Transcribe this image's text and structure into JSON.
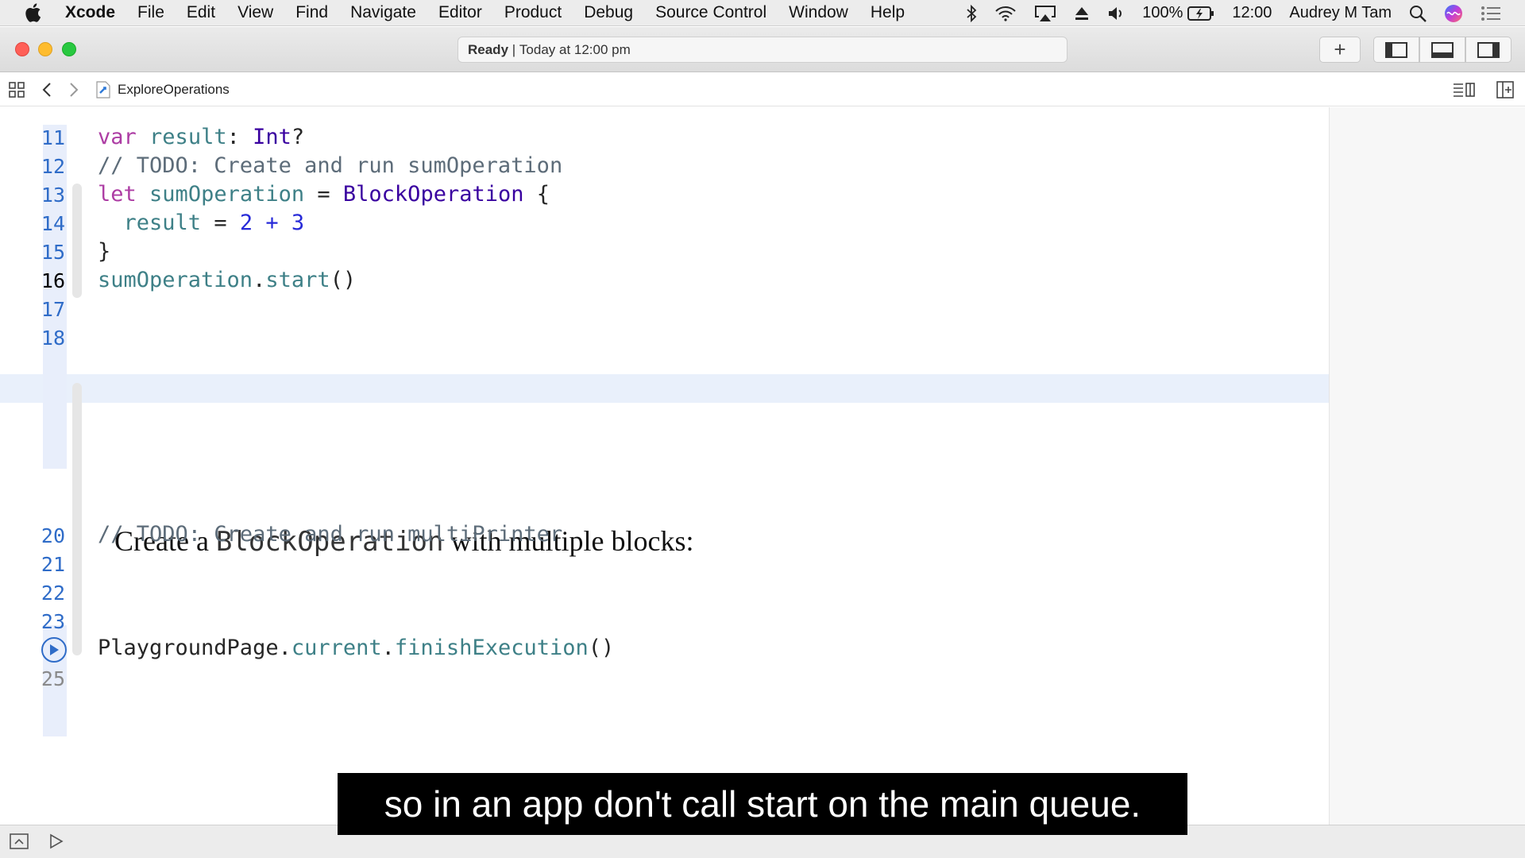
{
  "menubar": {
    "app_name": "Xcode",
    "items": [
      "File",
      "Edit",
      "View",
      "Find",
      "Navigate",
      "Editor",
      "Product",
      "Debug",
      "Source Control",
      "Window",
      "Help"
    ],
    "battery": "100%",
    "clock": "12:00",
    "user": "Audrey M Tam"
  },
  "toolbar": {
    "activity_status": "Ready",
    "activity_separator": " | ",
    "activity_time": "Today at 12:00 pm",
    "add_label": "+"
  },
  "jumpbar": {
    "file_name": "ExploreOperations"
  },
  "editor": {
    "line_numbers": {
      "l11": "11",
      "l12": "12",
      "l13": "13",
      "l14": "14",
      "l15": "15",
      "l16": "16",
      "l17": "17",
      "l18": "18",
      "l20": "20",
      "l21": "21",
      "l22": "22",
      "l23": "23",
      "l25": "25"
    },
    "code": {
      "l11_kw": "var",
      "l11_ident": "result",
      "l11_colon": ": ",
      "l11_type": "Int",
      "l11_q": "?",
      "l12": "// TODO: Create and run sumOperation",
      "l13_kw": "let",
      "l13_ident": "sumOperation",
      "l13_eq": " = ",
      "l13_type": "BlockOperation",
      "l13_brace": " {",
      "l14_ident": "result",
      "l14_eq": " = ",
      "l14_n1": "2",
      "l14_plus": " + ",
      "l14_n2": "3",
      "l15": "}",
      "l16_ident": "sumOperation",
      "l16_dot": ".",
      "l16_method": "start",
      "l16_parens": "()",
      "l20": "// TODO: Create and run multiPrinter",
      "l24_type": "PlaygroundPage",
      "l24_dot1": ".",
      "l24_prop": "current",
      "l24_dot2": ".",
      "l24_method": "finishExecution",
      "l24_parens": "()"
    },
    "markup": {
      "prefix": "Create a ",
      "code": "BlockOperation",
      "suffix": " with multiple blocks:"
    }
  },
  "subtitle": "so in an app don't call start on the main queue.",
  "colors": {
    "keyword": "#ad3da4",
    "type": "#3900a0",
    "identifier": "#3e8087",
    "number": "#272ad8",
    "comment": "#5d6c79",
    "line_number": "#2f6cc8",
    "current_line": "#e9f0fb"
  },
  "icons": [
    "apple-icon",
    "bluetooth-icon",
    "wifi-icon",
    "airplay-icon",
    "eject-icon",
    "volume-icon",
    "battery-icon",
    "search-icon",
    "siri-icon",
    "notification-center-icon",
    "grid-icon",
    "chevron-left-icon",
    "chevron-right-icon",
    "playground-file-icon",
    "editor-options-icon",
    "add-editor-icon",
    "navigator-toggle-icon",
    "debug-area-toggle-icon",
    "inspector-toggle-icon",
    "run-icon",
    "debug-area-icon",
    "play-icon"
  ]
}
